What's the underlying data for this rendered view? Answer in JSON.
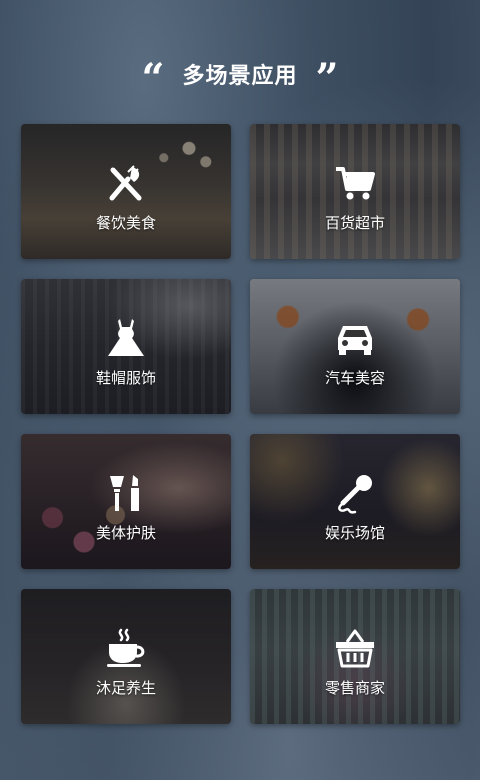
{
  "header": {
    "open_quote": "“",
    "title": "多场景应用",
    "close_quote": "”"
  },
  "scenes": [
    {
      "label": "餐饮美食",
      "icon": "fork-knife-icon"
    },
    {
      "label": "百货超市",
      "icon": "shopping-cart-icon"
    },
    {
      "label": "鞋帽服饰",
      "icon": "dress-icon"
    },
    {
      "label": "汽车美容",
      "icon": "car-icon"
    },
    {
      "label": "美体护肤",
      "icon": "makeup-brush-icon"
    },
    {
      "label": "娱乐场馆",
      "icon": "microphone-icon"
    },
    {
      "label": "沐足养生",
      "icon": "tea-cup-icon"
    },
    {
      "label": "零售商家",
      "icon": "basket-icon"
    }
  ]
}
